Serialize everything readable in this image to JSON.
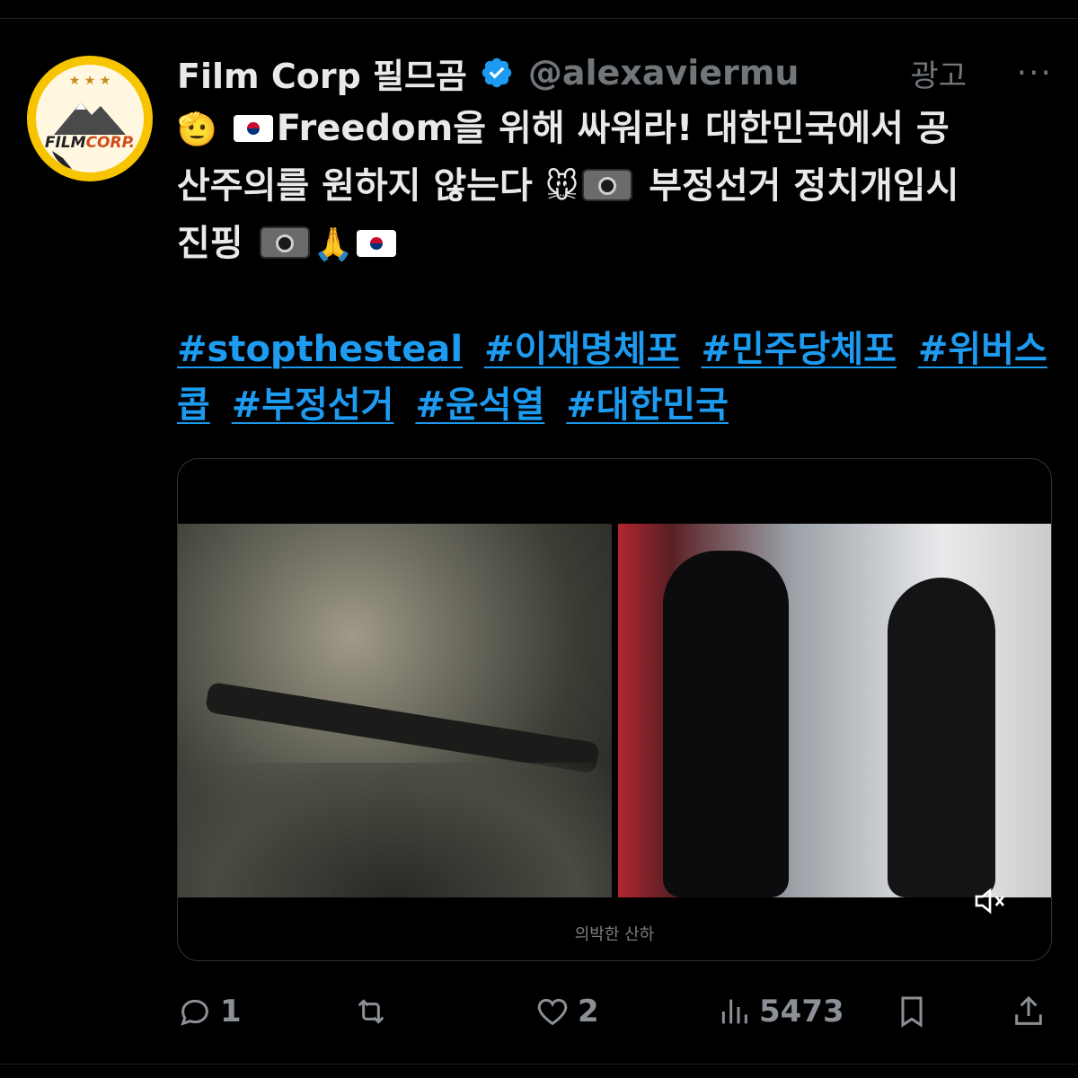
{
  "tweet": {
    "display_name": "Film Corp 필므곰",
    "handle": "@alexaviermu",
    "ad_label": "광고",
    "more": "···",
    "text_line1_after_flag": "Freedom을 위해 싸워라! 대한민국에서 공",
    "text_line2_before_mouse": "산주의를 원하지 않는다",
    "text_line2_after_camera": "부정선거 정치개입시",
    "text_line3_before_camera": "진핑",
    "hashtags": [
      "#stopthesteal",
      "#이재명체포",
      "#민주당체포",
      "#위버스콥",
      "#부정선거",
      "#윤석열",
      "#대한민국"
    ],
    "video_caption": "의박한 산하",
    "avatar_logo_text": "FILMCORP"
  },
  "actions": {
    "reply_count": "1",
    "retweet_count": "",
    "like_count": "2",
    "views_count": "5473"
  },
  "icons": {
    "verified": "verified-badge-icon",
    "reply": "reply-icon",
    "retweet": "retweet-icon",
    "like": "heart-icon",
    "views": "views-chart-icon",
    "bookmark": "bookmark-icon",
    "share": "share-icon",
    "mute": "speaker-muted-icon"
  },
  "colors": {
    "background": "#000000",
    "text": "#e7e9ea",
    "secondary": "#71767b",
    "link": "#1d9bf0",
    "avatar_ring": "#f7c400"
  }
}
